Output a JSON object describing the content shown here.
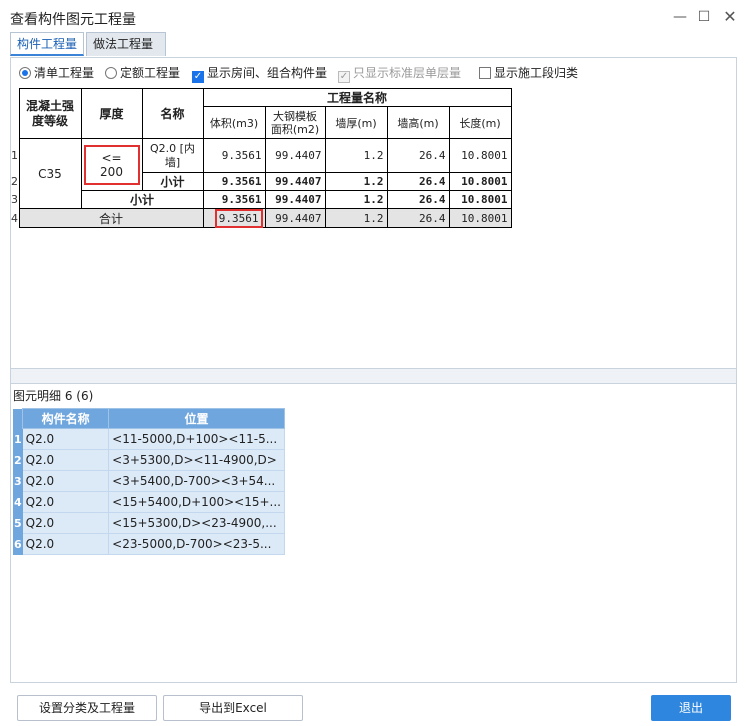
{
  "window": {
    "title": "查看构件图元工程量",
    "min": "—",
    "max": "☐",
    "close": "✕"
  },
  "tabs": [
    "构件工程量",
    "做法工程量"
  ],
  "options": {
    "list_qty": "清单工程量",
    "quota_qty": "定额工程量",
    "show_room": "显示房间、组合构件量",
    "standard_floor": "只显示标准层单层量",
    "construction": "显示施工段归类"
  },
  "qty_table": {
    "headers": {
      "grade": "混凝土强度等级",
      "thickness": "厚度",
      "name": "名称",
      "group": "工程量名称",
      "volume": "体积(m3)",
      "formwork": "大钢模板面积(m2)",
      "wall_thick": "墙厚(m)",
      "wall_height": "墙高(m)",
      "length": "长度(m)"
    },
    "rownums": [
      "1",
      "2",
      "3",
      "4"
    ],
    "grade": "C35",
    "thickness": "<= 200",
    "name": "Q2.0 [内墙]",
    "row1": {
      "volume": "9.3561",
      "formwork": "99.4407",
      "wall_thick": "1.2",
      "wall_height": "26.4",
      "length": "10.8001"
    },
    "subtotal1": {
      "label": "小计",
      "volume": "9.3561",
      "formwork": "99.4407",
      "wall_thick": "1.2",
      "wall_height": "26.4",
      "length": "10.8001"
    },
    "subtotal2": {
      "label": "小计",
      "volume": "9.3561",
      "formwork": "99.4407",
      "wall_thick": "1.2",
      "wall_height": "26.4",
      "length": "10.8001"
    },
    "total": {
      "label": "合计",
      "volume": "9.3561",
      "formwork": "99.4407",
      "wall_thick": "1.2",
      "wall_height": "26.4",
      "length": "10.8001"
    }
  },
  "detail": {
    "label": "图元明细  6 (6)",
    "headers": {
      "name": "构件名称",
      "position": "位置"
    },
    "rows": [
      {
        "idx": "1",
        "name": "Q2.0",
        "position": "<11-5000,D+100><11-5..."
      },
      {
        "idx": "2",
        "name": "Q2.0",
        "position": "<3+5300,D><11-4900,D>"
      },
      {
        "idx": "3",
        "name": "Q2.0",
        "position": "<3+5400,D-700><3+54..."
      },
      {
        "idx": "4",
        "name": "Q2.0",
        "position": "<15+5400,D+100><15+..."
      },
      {
        "idx": "5",
        "name": "Q2.0",
        "position": "<15+5300,D><23-4900,..."
      },
      {
        "idx": "6",
        "name": "Q2.0",
        "position": "<23-5000,D-700><23-5..."
      }
    ]
  },
  "footer": {
    "setup": "设置分类及工程量",
    "export": "导出到Excel",
    "exit": "退出"
  }
}
